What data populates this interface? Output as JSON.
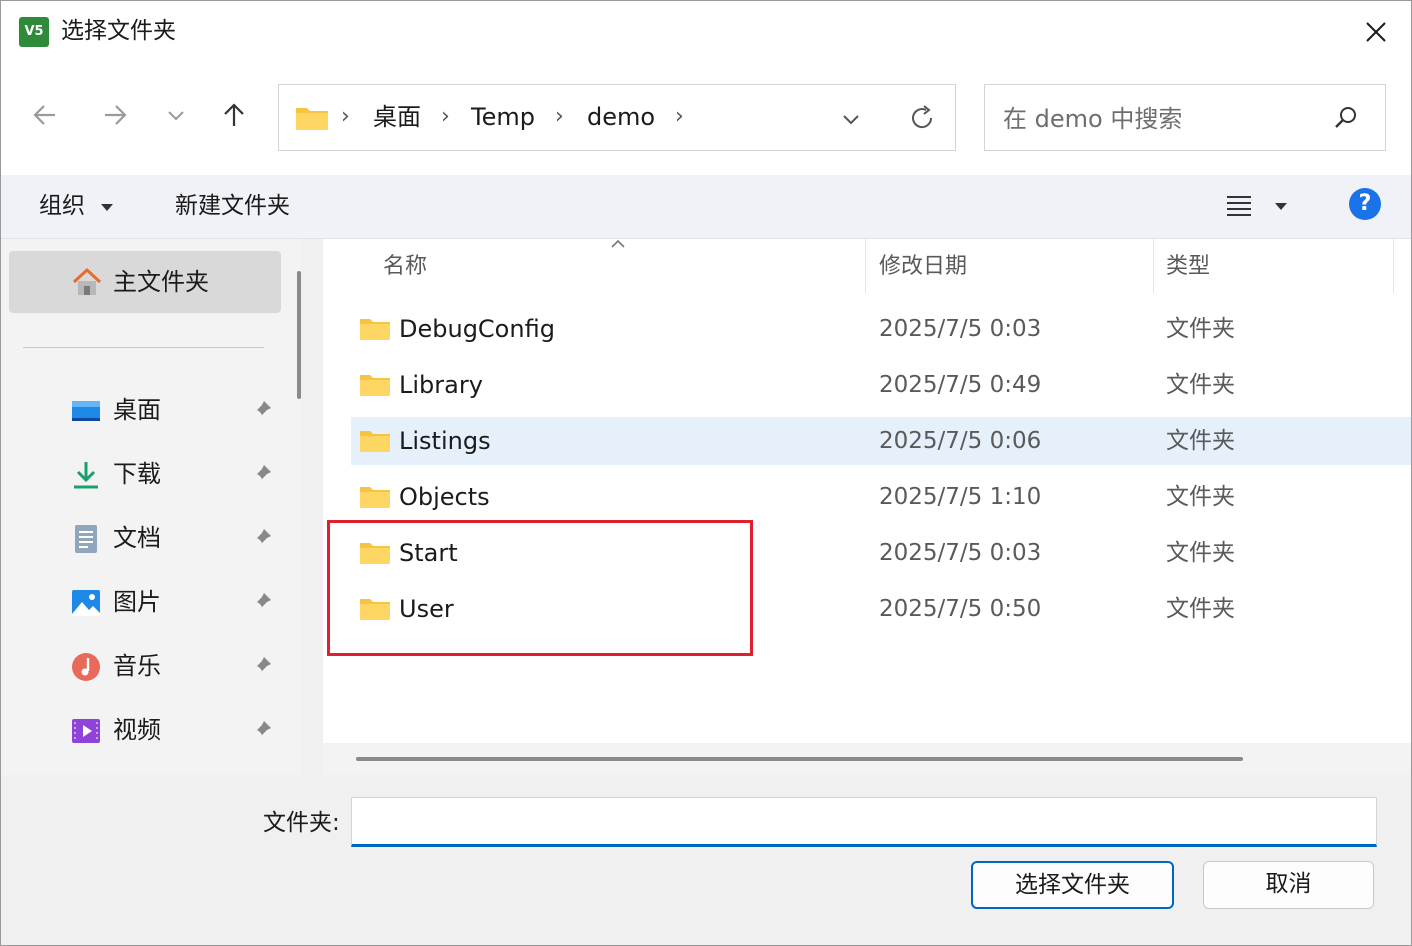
{
  "window": {
    "title": "选择文件夹",
    "app_icon_text": "V5"
  },
  "address_bar": {
    "crumbs": [
      "桌面",
      "Temp",
      "demo"
    ]
  },
  "search": {
    "placeholder": "在 demo 中搜索"
  },
  "toolbar": {
    "organize_label": "组织",
    "new_folder_label": "新建文件夹",
    "help_label": "?"
  },
  "sidebar": {
    "home_label": "主文件夹",
    "items": [
      {
        "label": "桌面",
        "icon": "desktop-icon"
      },
      {
        "label": "下载",
        "icon": "download-icon"
      },
      {
        "label": "文档",
        "icon": "document-icon"
      },
      {
        "label": "图片",
        "icon": "picture-icon"
      },
      {
        "label": "音乐",
        "icon": "music-icon"
      },
      {
        "label": "视频",
        "icon": "video-icon"
      }
    ]
  },
  "file_list": {
    "columns": {
      "name": "名称",
      "modified": "修改日期",
      "type": "类型"
    },
    "sort_column": "名称",
    "rows": [
      {
        "name": "DebugConfig",
        "modified": "2025/7/5 0:03",
        "type": "文件夹",
        "selected": false
      },
      {
        "name": "Library",
        "modified": "2025/7/5 0:49",
        "type": "文件夹",
        "selected": false
      },
      {
        "name": "Listings",
        "modified": "2025/7/5 0:06",
        "type": "文件夹",
        "selected": true
      },
      {
        "name": "Objects",
        "modified": "2025/7/5 1:10",
        "type": "文件夹",
        "selected": false
      },
      {
        "name": "Start",
        "modified": "2025/7/5 0:03",
        "type": "文件夹",
        "selected": false
      },
      {
        "name": "User",
        "modified": "2025/7/5 0:50",
        "type": "文件夹",
        "selected": false
      }
    ]
  },
  "footer": {
    "folder_label": "文件夹:",
    "folder_value": "",
    "select_button": "选择文件夹",
    "cancel_button": "取消"
  },
  "colors": {
    "accent": "#0067c0",
    "highlight_box": "#e0202e",
    "selected_row": "#e5f0fb",
    "folder": "#f6c343"
  }
}
